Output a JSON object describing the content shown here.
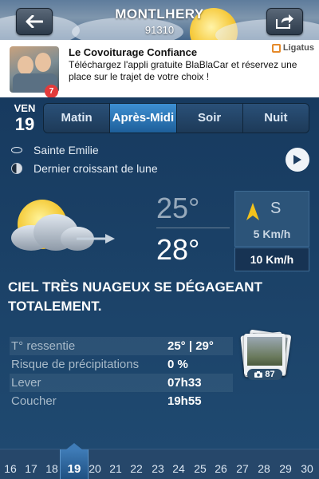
{
  "header": {
    "city": "MONTLHERY",
    "zip": "91310",
    "back_icon": "arrow-left-icon",
    "share_icon": "share-icon"
  },
  "ad": {
    "badge": "7",
    "title": "Le Covoiturage Confiance",
    "text": "Téléchargez l'appli gratuite BlaBlaCar et réservez une place sur le trajet de votre choix !",
    "brand": "Ligatus"
  },
  "day": {
    "name": "VEN",
    "number": "19"
  },
  "periods": [
    "Matin",
    "Après-Midi",
    "Soir",
    "Nuit"
  ],
  "active_period": "Après-Midi",
  "saint": "Sainte Emilie",
  "moon_phase": "Dernier croissant de lune",
  "temps": {
    "min": "25°",
    "max": "28°"
  },
  "wind": {
    "direction": "S",
    "speed": "5 Km/h",
    "gust": "10 Km/h"
  },
  "description": "CIEL TRÈS NUAGEUX SE DÉGAGEANT TOTALEMENT.",
  "details": [
    {
      "label": "T° ressentie",
      "value": "25° | 29°"
    },
    {
      "label": "Risque de précipitations",
      "value": "0 %"
    },
    {
      "label": "Lever",
      "value": "07h33"
    },
    {
      "label": "Coucher",
      "value": "19h55"
    }
  ],
  "photos": {
    "count": "87",
    "icon": "camera-icon"
  },
  "day_strip": [
    "16",
    "17",
    "18",
    "19",
    "20",
    "21",
    "22",
    "23",
    "24",
    "25",
    "26",
    "27",
    "28",
    "29",
    "30"
  ],
  "selected_day": "19",
  "colors": {
    "background": "#1d3e62",
    "active_tab": "#3d8fd2",
    "sun": "#f3c62f",
    "wind_arrow": "#f2c21c"
  }
}
